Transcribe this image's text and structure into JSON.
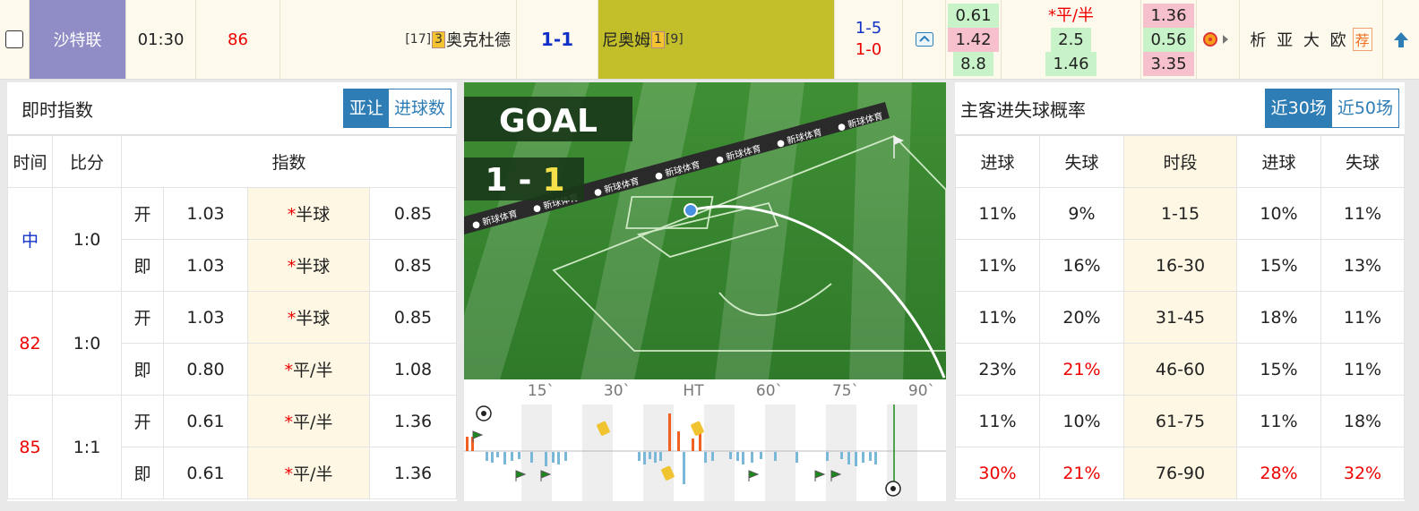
{
  "match": {
    "league": "沙特联",
    "kickoff": "01:30",
    "minute": "86",
    "home_rank": "[17]",
    "home_cards": "3",
    "home_team": "奥克杜德",
    "score": "1-1",
    "away_team": "尼奥姆",
    "away_cards": "1",
    "away_rank": "[9]",
    "half_score_1": "1-5",
    "half_score_2": "1-0",
    "odds_col1": [
      "0.61",
      "1.42",
      "8.8"
    ],
    "odds_col2": [
      "*平/半",
      "2.5",
      "1.46"
    ],
    "odds_col3": [
      "1.36",
      "0.56",
      "3.35"
    ],
    "links": "析 亚 大 欧",
    "recommend": "荐"
  },
  "left_panel": {
    "title": "即时指数",
    "tab_active": "亚让",
    "tab_other": "进球数",
    "headers": [
      "时间",
      "比分",
      "指数"
    ],
    "groups": [
      {
        "time": "中",
        "score": "1:0",
        "rows": [
          {
            "type": "开",
            "a": "1.03",
            "line": "半球",
            "b": "0.85"
          },
          {
            "type": "即",
            "a": "1.03",
            "line": "半球",
            "b": "0.85"
          }
        ]
      },
      {
        "time": "82",
        "score": "1:0",
        "rows": [
          {
            "type": "开",
            "a": "1.03",
            "line": "半球",
            "b": "0.85"
          },
          {
            "type": "即",
            "a": "0.80",
            "line": "平/半",
            "b": "1.08"
          }
        ]
      },
      {
        "time": "85",
        "score": "1:1",
        "rows": [
          {
            "type": "开",
            "a": "0.61",
            "line": "平/半",
            "b": "1.36"
          },
          {
            "type": "即",
            "a": "0.61",
            "line": "平/半",
            "b": "1.36"
          }
        ]
      }
    ]
  },
  "pitch": {
    "goal_text": "GOAL",
    "score_home": "1",
    "score_sep": "-",
    "score_away": "1",
    "ad_text": "新球体育",
    "timeline_labels": [
      "15`",
      "30`",
      "HT",
      "60`",
      "75`",
      "90`"
    ]
  },
  "right_panel": {
    "title": "主客进失球概率",
    "tab_active": "近30场",
    "tab_other": "近50场",
    "headers": [
      "进球",
      "失球",
      "时段",
      "进球",
      "失球"
    ],
    "rows": [
      {
        "hg": "11%",
        "hl": "9%",
        "period": "1-15",
        "ag": "10%",
        "al": "11%"
      },
      {
        "hg": "11%",
        "hl": "16%",
        "period": "16-30",
        "ag": "15%",
        "al": "13%"
      },
      {
        "hg": "11%",
        "hl": "20%",
        "period": "31-45",
        "ag": "18%",
        "al": "11%"
      },
      {
        "hg": "23%",
        "hl": "21%",
        "period": "46-60",
        "ag": "15%",
        "al": "11%"
      },
      {
        "hg": "11%",
        "hl": "10%",
        "period": "61-75",
        "ag": "11%",
        "al": "18%"
      },
      {
        "hg": "30%",
        "hl": "21%",
        "period": "76-90",
        "ag": "28%",
        "al": "32%"
      }
    ]
  },
  "colors": {
    "accent": "#2e7db5",
    "league_bg": "#8f8cc6",
    "away_bg": "#c3bf2a",
    "red": "#e00000"
  }
}
